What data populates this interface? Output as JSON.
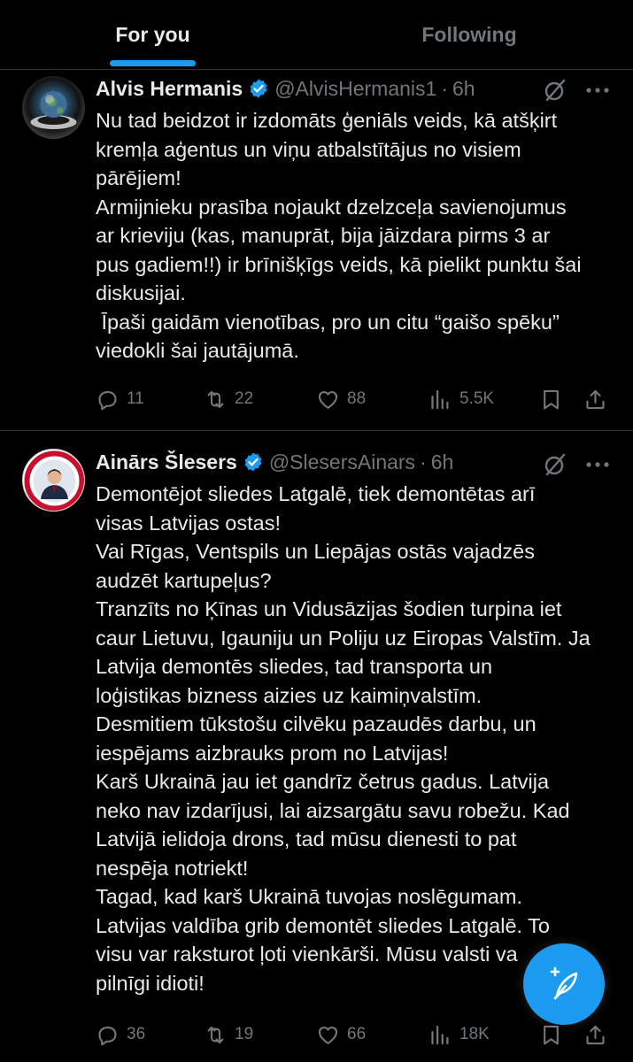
{
  "tabs": {
    "for_you": "For you",
    "following": "Following"
  },
  "colors": {
    "accent": "#1d9bf0",
    "text": "#e7e9ea",
    "muted": "#71767b",
    "divider": "#2f3336",
    "background": "#000000"
  },
  "tweets": [
    {
      "name": "Alvis Hermanis",
      "handle": "@AlvisHermanis1",
      "sep": "·",
      "time": "6h",
      "lines": [
        "Nu tad beidzot ir izdomāts ģeniāls veids, kā atšķirt",
        "kremļa aģentus un viņu atbalstītājus no visiem",
        "pārējiem!",
        "Armijnieku prasība nojaukt dzelzceļa savienojumus",
        "ar krieviju (kas, manuprāt, bija jāizdara pirms 3 ar",
        "pus gadiem!!) ir brīnišķīgs veids, kā pielikt punktu šai",
        "diskusijai.",
        " Īpaši gaidām vienotības, pro un citu “gaišo spēku”",
        "viedokli šai jautājumā."
      ],
      "stats": {
        "replies": "11",
        "reposts": "22",
        "likes": "88",
        "views": "5.5K"
      }
    },
    {
      "name": "Ainārs Šlesers",
      "handle": "@SlesersAinars",
      "sep": "·",
      "time": "6h",
      "lines": [
        "Demontējot sliedes Latgalē, tiek demontētas arī",
        "visas Latvijas ostas!",
        "Vai Rīgas, Ventspils un Liepājas ostās vajadzēs",
        "audzēt kartupeļus?",
        "Tranzīts no Ķīnas un Vidusāzijas šodien turpina iet",
        "caur Lietuvu, Igauniju un Poliju uz Eiropas Valstīm. Ja",
        "Latvija demontēs sliedes, tad transporta un",
        "loģistikas bizness aizies uz kaimiņvalstīm.",
        "Desmitiem tūkstošu cilvēku pazaudēs darbu, un",
        "iespējams aizbrauks prom no Latvijas!",
        "Karš Ukrainā jau iet gandrīz četrus gadus. Latvija",
        "neko nav izdarījusi, lai aizsargātu savu robežu. Kad",
        "Latvijā ielidoja drons, tad mūsu dienesti to pat",
        "nespēja notriekt!",
        "Tagad, kad karš Ukrainā tuvojas noslēgumam.",
        "Latvijas valdība grib demontēt sliedes Latgalē. To",
        "visu var raksturot ļoti vienkārši. Mūsu valsti va",
        "pilnīgi idioti!"
      ],
      "stats": {
        "replies": "36",
        "reposts": "19",
        "likes": "66",
        "views": "18K"
      }
    }
  ],
  "icons": {
    "verified": "verified-badge-icon",
    "grok": "grok-icon",
    "more": "more-icon",
    "reply": "reply-icon",
    "repost": "repost-icon",
    "like": "like-icon",
    "views": "views-icon",
    "bookmark": "bookmark-icon",
    "share": "share-icon",
    "compose": "compose-post-icon"
  }
}
